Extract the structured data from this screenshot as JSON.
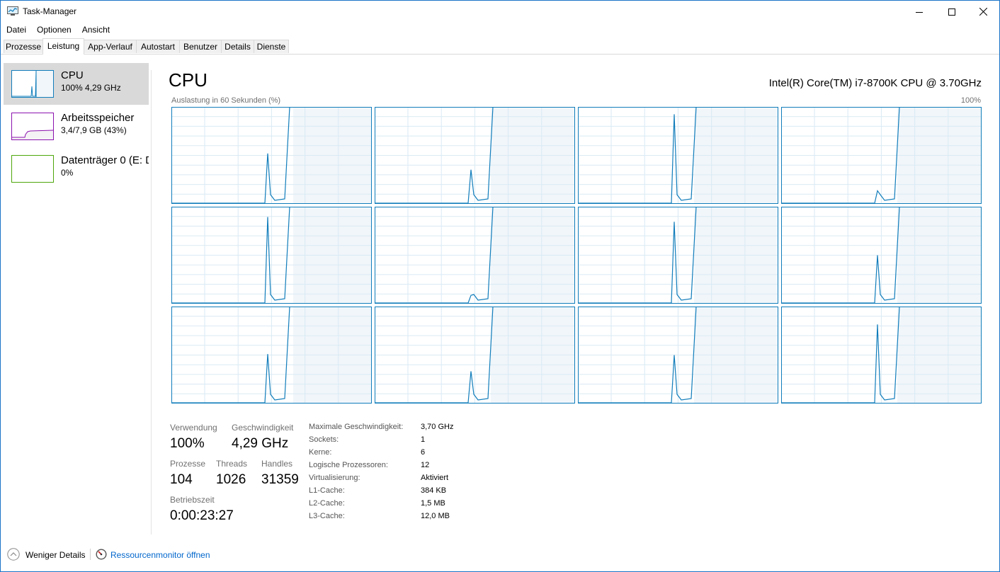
{
  "window": {
    "title": "Task-Manager",
    "controls": {
      "minimize": "minimize-icon",
      "maximize": "maximize-icon",
      "close": "close-icon"
    }
  },
  "menu": [
    "Datei",
    "Optionen",
    "Ansicht"
  ],
  "tabs": [
    {
      "label": "Prozesse",
      "active": false
    },
    {
      "label": "Leistung",
      "active": true
    },
    {
      "label": "App-Verlauf",
      "active": false
    },
    {
      "label": "Autostart",
      "active": false
    },
    {
      "label": "Benutzer",
      "active": false
    },
    {
      "label": "Details",
      "active": false
    },
    {
      "label": "Dienste",
      "active": false
    }
  ],
  "sidebar": {
    "items": [
      {
        "name": "CPU",
        "sub": "100% 4,29 GHz",
        "selected": true,
        "color": "#117dbb"
      },
      {
        "name": "Arbeitsspeicher",
        "sub": "3,4/7,9 GB (43%)",
        "selected": false,
        "color": "#8b12ae"
      },
      {
        "name": "Datenträger 0 (E: D",
        "sub": "0%",
        "selected": false,
        "color": "#4da60c"
      }
    ]
  },
  "main": {
    "title": "CPU",
    "cpu_name": "Intel(R) Core(TM) i7-8700K CPU @ 3.70GHz",
    "graph_label": "Auslastung in 60 Sekunden (%)",
    "graph_max": "100%",
    "graph_color": "#117dbb",
    "graph_fill": "#f1f6fa",
    "graph_border": "#117dbb",
    "grid_color": "#d9eaf4",
    "cores_peak_percent": [
      52,
      35,
      93,
      13,
      90,
      8,
      85,
      50,
      51,
      33,
      50,
      82
    ]
  },
  "stats": {
    "usage": {
      "label": "Verwendung",
      "value": "100%"
    },
    "speed": {
      "label": "Geschwindigkeit",
      "value": "4,29 GHz"
    },
    "processes": {
      "label": "Prozesse",
      "value": "104"
    },
    "threads": {
      "label": "Threads",
      "value": "1026"
    },
    "handles": {
      "label": "Handles",
      "value": "31359"
    },
    "uptime": {
      "label": "Betriebszeit",
      "value": "0:00:23:27"
    }
  },
  "info": [
    {
      "label": "Maximale Geschwindigkeit:",
      "value": "3,70 GHz"
    },
    {
      "label": "Sockets:",
      "value": "1"
    },
    {
      "label": "Kerne:",
      "value": "6"
    },
    {
      "label": "Logische Prozessoren:",
      "value": "12"
    },
    {
      "label": "Virtualisierung:",
      "value": "Aktiviert"
    },
    {
      "label": "L1-Cache:",
      "value": "384 KB"
    },
    {
      "label": "L2-Cache:",
      "value": "1,5 MB"
    },
    {
      "label": "L3-Cache:",
      "value": "12,0 MB"
    }
  ],
  "footer": {
    "less_details": "Weniger Details",
    "resource_monitor": "Ressourcenmonitor öffnen"
  }
}
